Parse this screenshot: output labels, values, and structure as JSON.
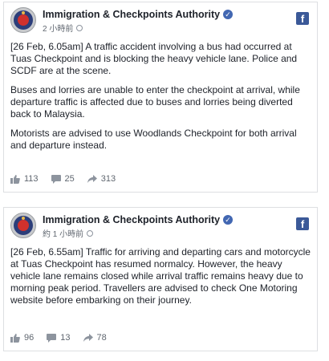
{
  "posts": [
    {
      "page_name": "Immigration & Checkpoints Authority",
      "timestamp": "2 小時前",
      "paragraphs": [
        "[26 Feb, 6.05am] A traffic accident involving a bus had occurred at Tuas Checkpoint and is blocking the heavy vehicle lane. Police and SCDF are at the scene.",
        "Buses and lorries are unable to enter the checkpoint at arrival, while departure traffic is affected due to buses and lorries being diverted back to Malaysia.",
        "Motorists are advised to use Woodlands Checkpoint for both arrival and departure instead."
      ],
      "likes": "113",
      "comments": "25",
      "shares": "313"
    },
    {
      "page_name": "Immigration & Checkpoints Authority",
      "timestamp": "約 1 小時前",
      "paragraphs": [
        "[26 Feb, 6.55am] Traffic for arriving and departing cars and motorcycle at Tuas Checkpoint has resumed normalcy. However, the heavy vehicle lane remains closed while arrival traffic remains heavy due to morning peak period. Travellers are advised to check One Motoring website before embarking on their journey."
      ],
      "likes": "96",
      "comments": "13",
      "shares": "78"
    }
  ],
  "icons": {
    "verified": "verified-badge-icon",
    "facebook": "facebook-logo-icon",
    "like": "thumbs-up-icon",
    "comment": "comment-bubble-icon",
    "share": "share-arrow-icon"
  },
  "colors": {
    "brand": "#3b5998",
    "verified": "#4267b2",
    "meta_text": "#606770",
    "border": "#dddfe2"
  }
}
